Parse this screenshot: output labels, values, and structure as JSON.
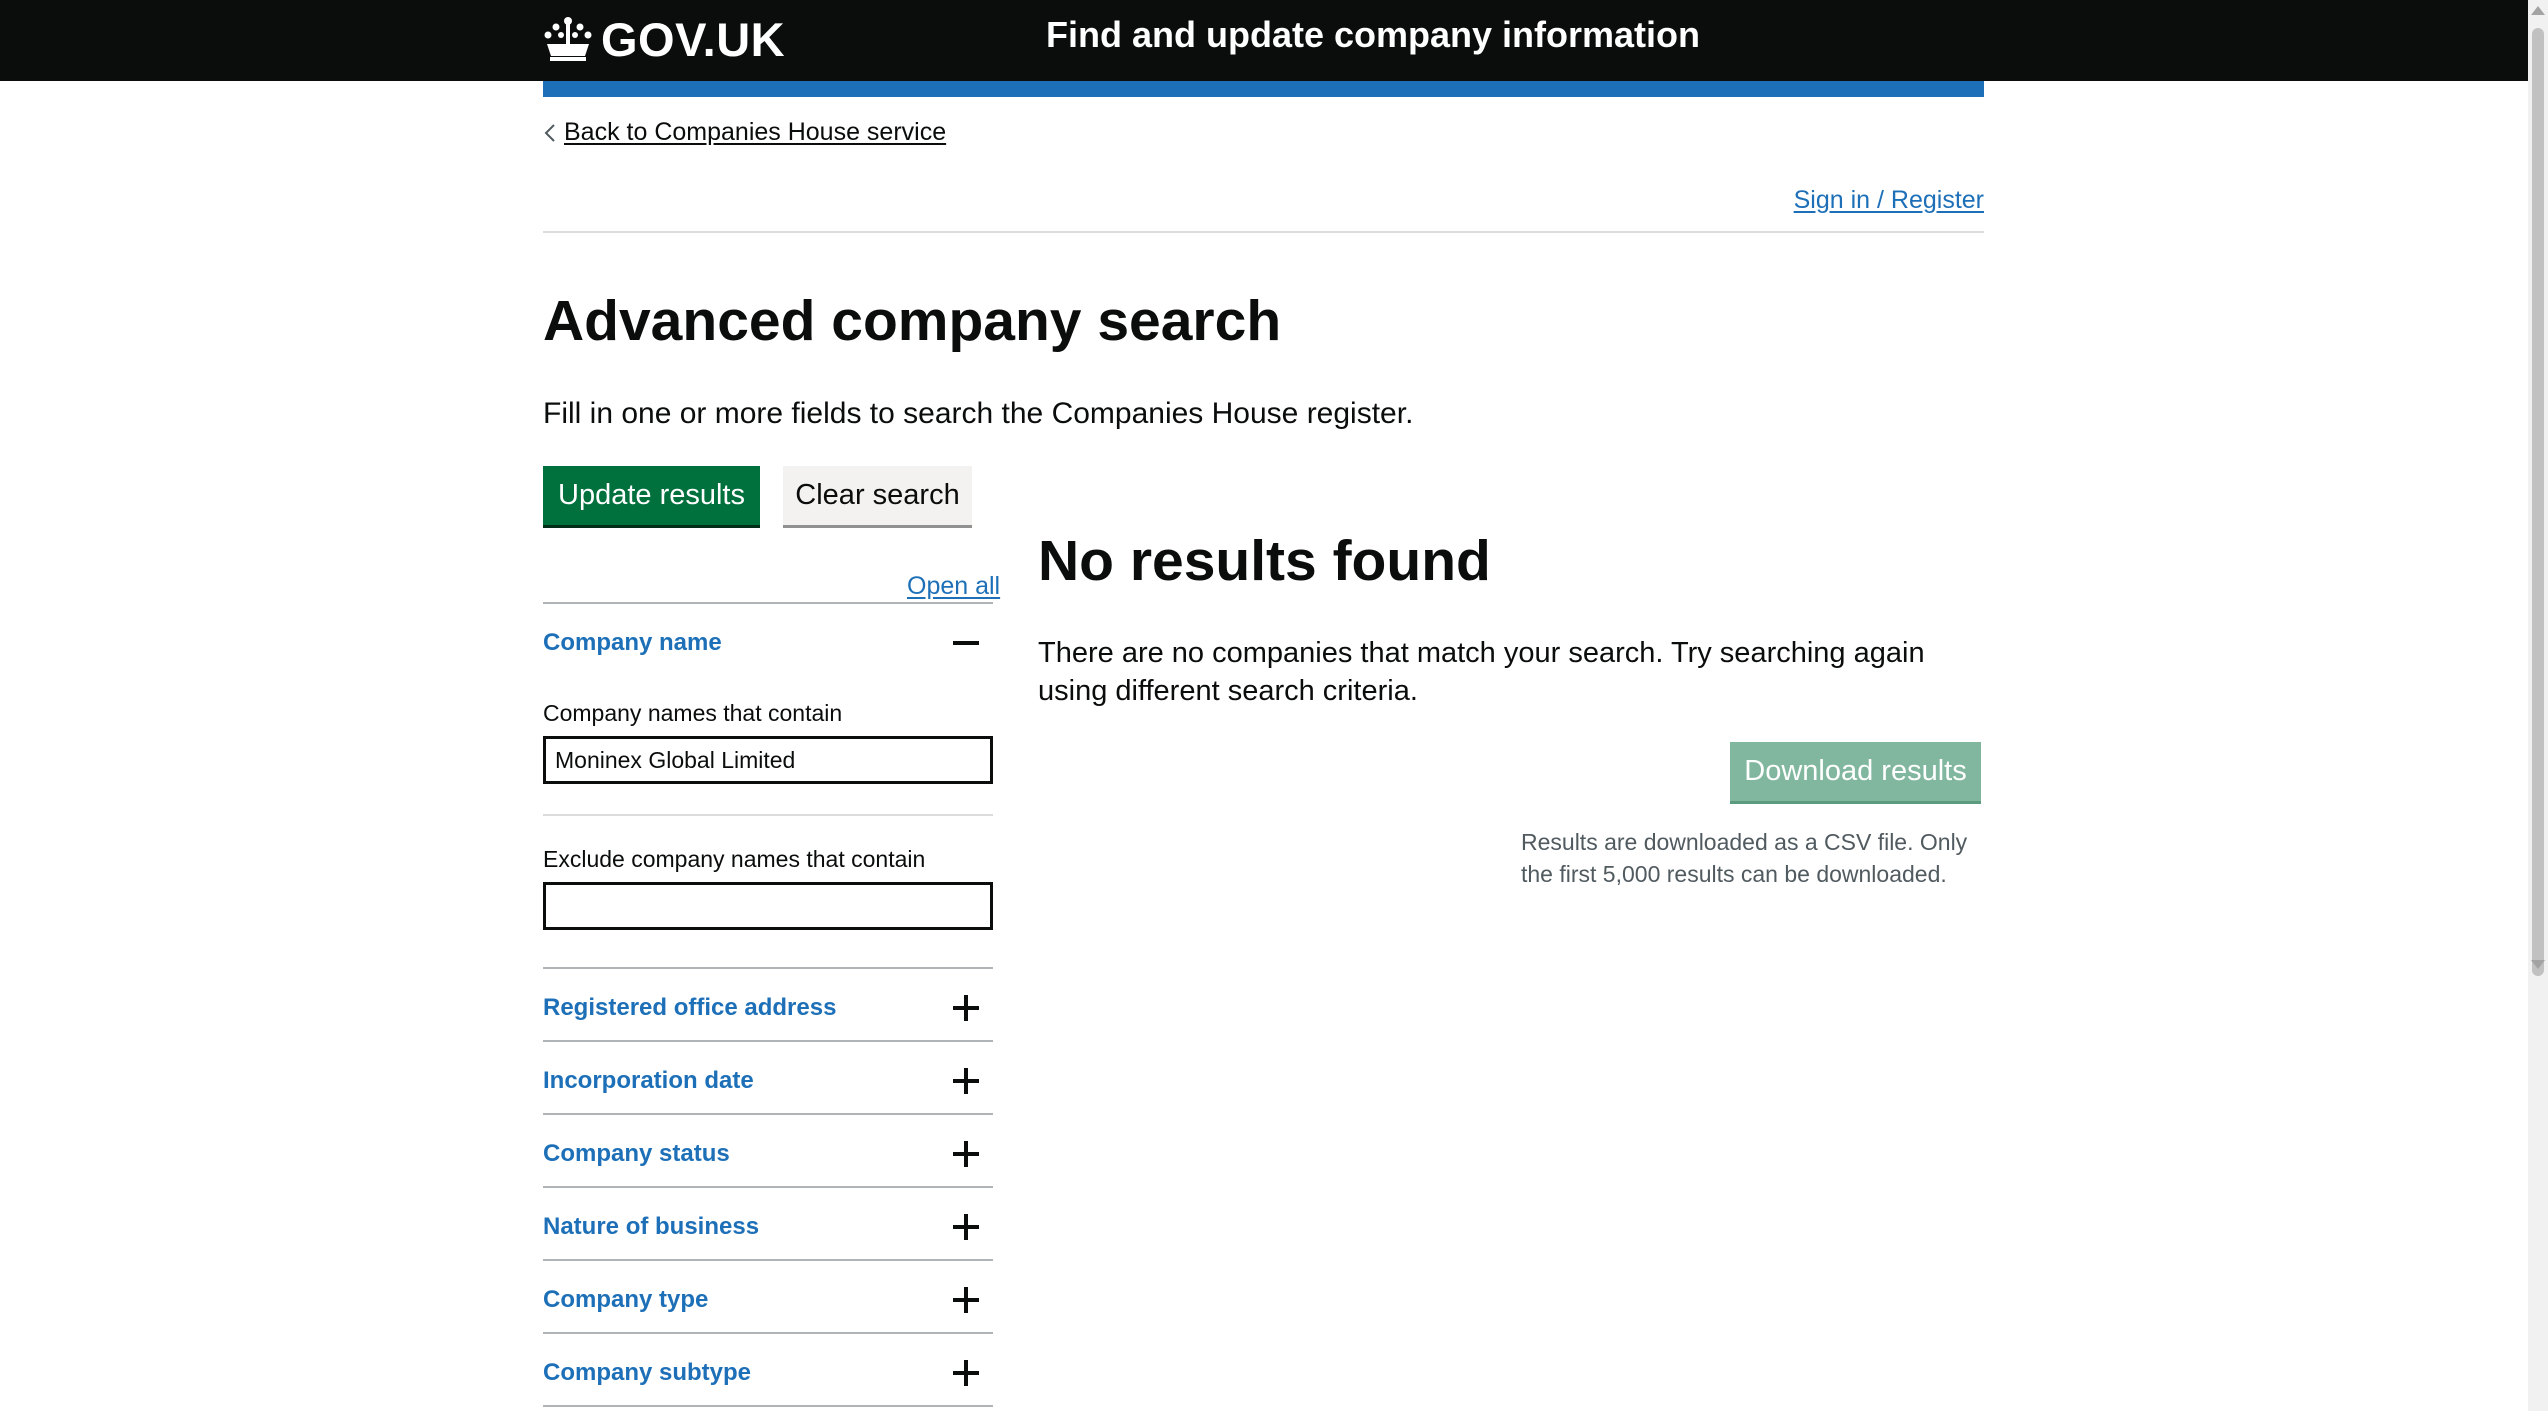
{
  "header": {
    "logo_text": "GOV.UK",
    "service_name": "Find and update company information"
  },
  "nav": {
    "back_link": "Back to Companies House service",
    "sign_in": "Sign in / Register"
  },
  "main": {
    "title": "Advanced company search",
    "lead": "Fill in one or more fields to search the Companies House register.",
    "update_button": "Update results",
    "clear_button": "Clear search"
  },
  "filters": {
    "open_all": "Open all",
    "company_name": {
      "label": "Company name",
      "contain_label": "Company names that contain",
      "contain_value": "Moninex Global Limited",
      "exclude_label": "Exclude company names that contain",
      "exclude_value": ""
    },
    "sections": [
      {
        "label": "Registered office address"
      },
      {
        "label": "Incorporation date"
      },
      {
        "label": "Company status"
      },
      {
        "label": "Nature of business"
      },
      {
        "label": "Company type"
      },
      {
        "label": "Company subtype"
      }
    ]
  },
  "results": {
    "heading": "No results found",
    "message": "There are no companies that match your search. Try searching again using different search criteria.",
    "download_button": "Download results",
    "download_note": "Results are downloaded as a CSV file. Only the first 5,000 results can be downloaded."
  },
  "colors": {
    "header_bg": "#0b0c0c",
    "brand_blue": "#1d70b8",
    "link_blue": "#1d70b8",
    "button_green": "#00703c",
    "button_disabled_green": "#80b79e",
    "secondary_button": "#f3f2f1"
  }
}
